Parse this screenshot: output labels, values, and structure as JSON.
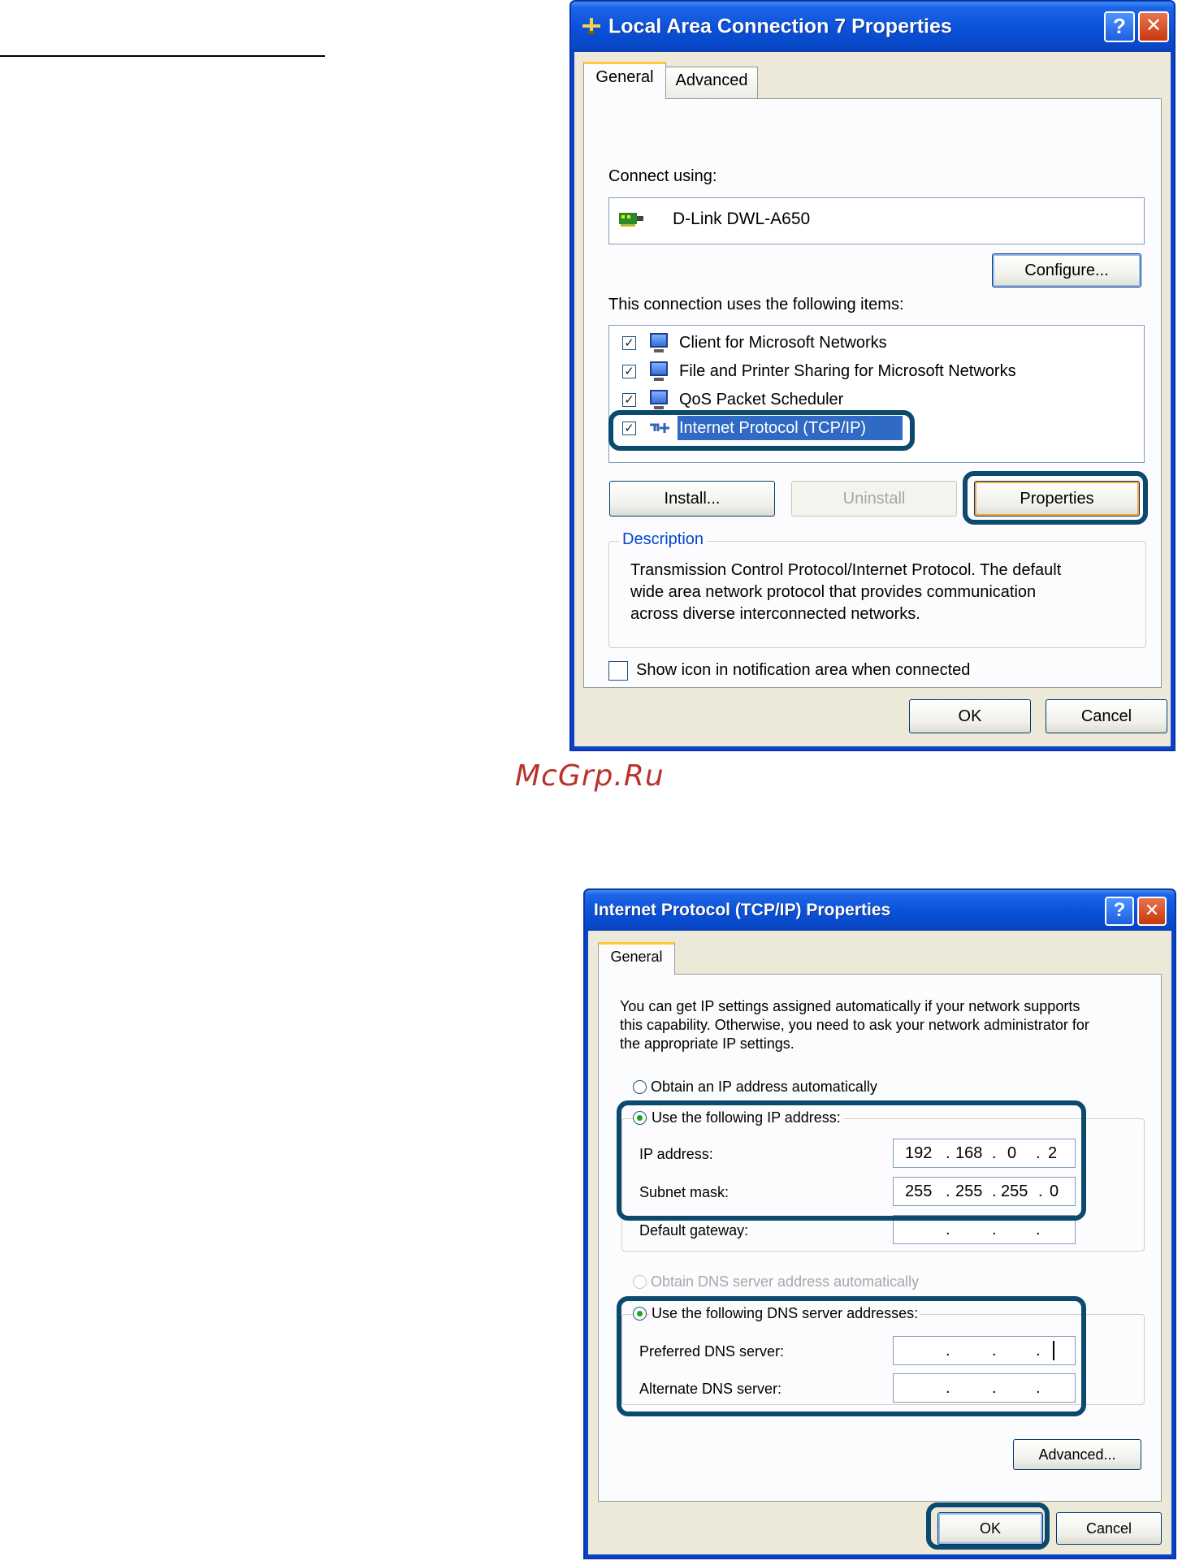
{
  "watermark": "McGrp.Ru",
  "dialog1": {
    "title": "Local Area Connection 7 Properties",
    "help_glyph": "?",
    "close_glyph": "✕",
    "tabs": [
      "General",
      "Advanced"
    ],
    "connect_using_label": "Connect using:",
    "adapter_name": "D-Link DWL-A650",
    "configure_button": "Configure...",
    "items_label": "This connection uses the following items:",
    "items": [
      {
        "label": "Client for Microsoft Networks",
        "checked": true,
        "icon": "network-client-icon"
      },
      {
        "label": "File and Printer Sharing for Microsoft Networks",
        "checked": true,
        "icon": "file-sharing-icon"
      },
      {
        "label": "QoS Packet Scheduler",
        "checked": true,
        "icon": "qos-icon"
      },
      {
        "label": "Internet Protocol (TCP/IP)",
        "checked": true,
        "icon": "protocol-icon",
        "selected": true
      }
    ],
    "install_button": "Install...",
    "uninstall_button": "Uninstall",
    "properties_button": "Properties",
    "description_title": "Description",
    "description_lines": [
      "Transmission Control Protocol/Internet Protocol. The default",
      "wide area network protocol that provides communication",
      "across diverse interconnected networks."
    ],
    "show_icon_label": "Show icon in notification area when connected",
    "ok_button": "OK",
    "cancel_button": "Cancel",
    "colors": {
      "highlight_outline": "#0b4a6e",
      "selection": "#316ac5"
    }
  },
  "dialog2": {
    "title": "Internet Protocol (TCP/IP) Properties",
    "tab": "General",
    "intro_lines": [
      "You can get IP settings assigned automatically if your network supports",
      "this capability. Otherwise, you need to ask your network administrator for",
      "the appropriate IP settings."
    ],
    "obtain_ip_auto": "Obtain an IP address automatically",
    "use_following_ip": "Use the following IP address:",
    "ip_address_label": "IP address:",
    "ip_address": [
      "192",
      "168",
      "0",
      "2"
    ],
    "subnet_mask_label": "Subnet mask:",
    "subnet_mask": [
      "255",
      "255",
      "255",
      "0"
    ],
    "default_gateway_label": "Default gateway:",
    "obtain_dns_auto": "Obtain DNS server address automatically",
    "use_following_dns": "Use the following DNS server addresses:",
    "preferred_dns_label": "Preferred DNS server:",
    "alternate_dns_label": "Alternate DNS server:",
    "advanced_button": "Advanced...",
    "ok_button": "OK",
    "cancel_button": "Cancel"
  }
}
